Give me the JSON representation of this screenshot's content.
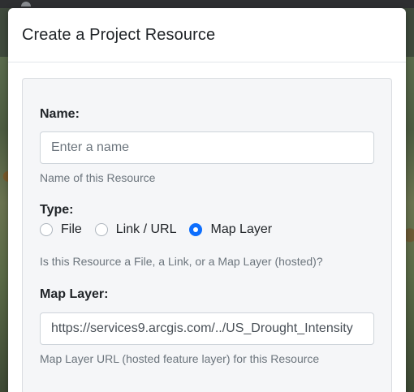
{
  "modal": {
    "title": "Create a Project Resource"
  },
  "form": {
    "name": {
      "label": "Name:",
      "placeholder": "Enter a name",
      "value": "",
      "help": "Name of this Resource"
    },
    "type": {
      "label": "Type:",
      "options": [
        {
          "label": "File",
          "checked": false
        },
        {
          "label": "Link / URL",
          "checked": false
        },
        {
          "label": "Map Layer",
          "checked": true
        }
      ],
      "help": "Is this Resource a File, a Link, or a Map Layer (hosted)?"
    },
    "map_layer": {
      "label": "Map Layer:",
      "value": "https://services9.arcgis.com/../US_Drought_Intensity",
      "help": "Map Layer URL (hosted feature layer) for this Resource"
    }
  },
  "colors": {
    "accent": "#0d6efd",
    "card_bg": "#f5f6f8",
    "help_text": "#6c757d"
  }
}
